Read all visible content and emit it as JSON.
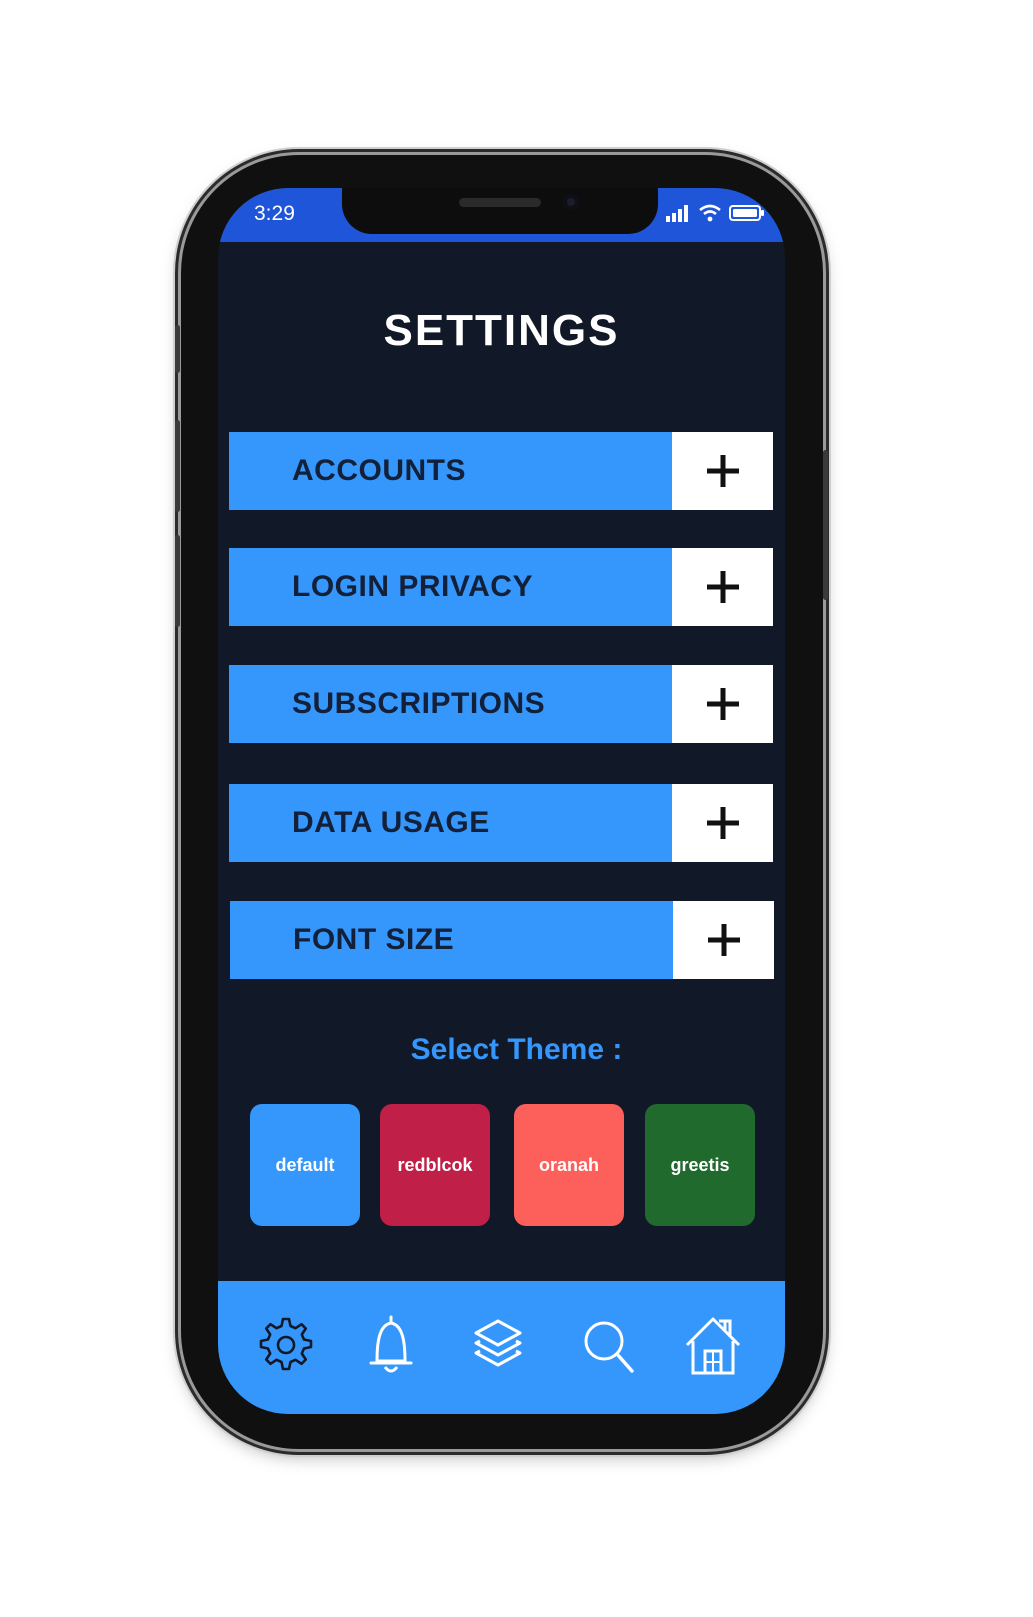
{
  "status_bar": {
    "time": "3:29",
    "icons": [
      "signal-icon",
      "wifi-icon",
      "battery-icon"
    ],
    "color": "#1f55d8"
  },
  "page": {
    "title": "SETTINGS",
    "background_color": "#111827"
  },
  "menu": {
    "items": [
      {
        "label": "ACCOUNTS",
        "action_icon": "plus-icon"
      },
      {
        "label": "LOGIN PRIVACY",
        "action_icon": "plus-icon"
      },
      {
        "label": "SUBSCRIPTIONS",
        "action_icon": "plus-icon"
      },
      {
        "label": "DATA USAGE",
        "action_icon": "plus-icon"
      },
      {
        "label": "FONT SIZE",
        "action_icon": "plus-icon"
      }
    ],
    "bar_color": "#3597fb"
  },
  "themes": {
    "heading": "Select Theme :",
    "options": [
      {
        "label": "default",
        "color": "#3597fb"
      },
      {
        "label": "redblcok",
        "color": "#c01f47"
      },
      {
        "label": "oranah",
        "color": "#fd5f5a"
      },
      {
        "label": "greetis",
        "color": "#216a2e"
      }
    ]
  },
  "bottom_nav": {
    "items": [
      "gear-icon",
      "bell-icon",
      "layers-icon",
      "search-icon",
      "home-icon"
    ],
    "color": "#3597fb"
  }
}
